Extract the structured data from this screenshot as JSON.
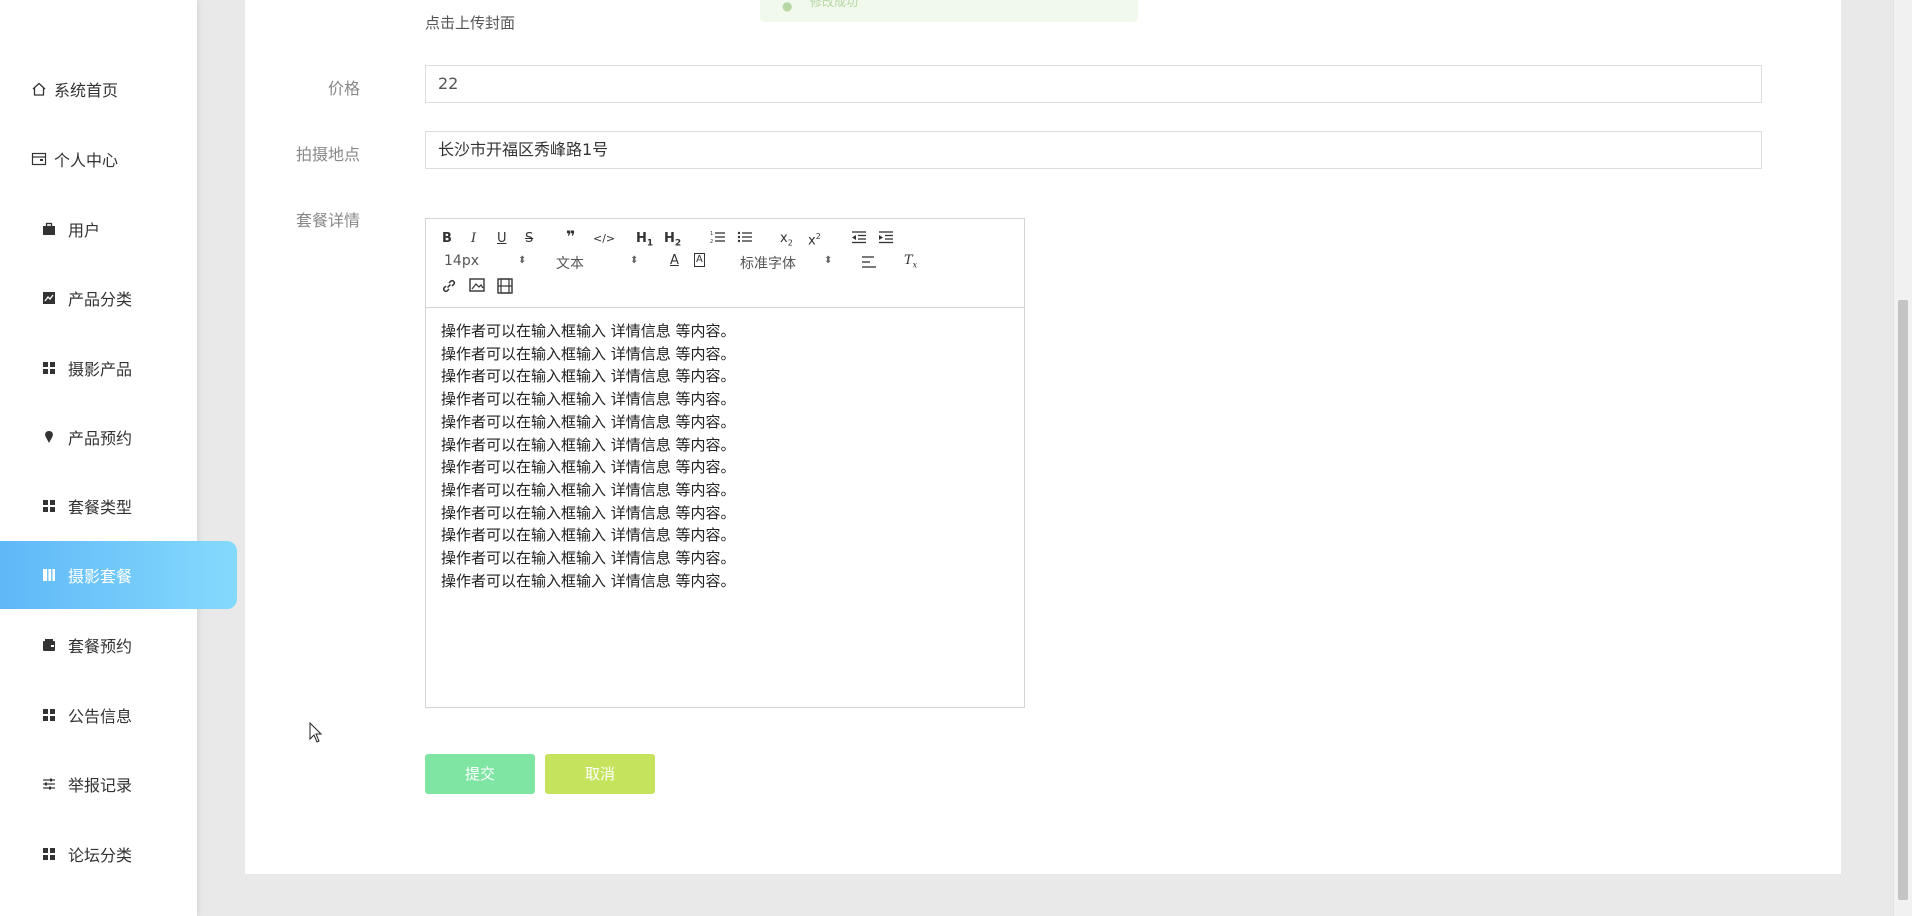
{
  "sidebar": {
    "items": [
      {
        "label": "系统首页",
        "icon": "home-icon"
      },
      {
        "label": "个人中心",
        "icon": "wallet-icon"
      },
      {
        "label": "用户",
        "icon": "briefcase-icon"
      },
      {
        "label": "产品分类",
        "icon": "chart-icon"
      },
      {
        "label": "摄影产品",
        "icon": "grid-icon"
      },
      {
        "label": "产品预约",
        "icon": "location-icon"
      },
      {
        "label": "套餐类型",
        "icon": "grid-icon"
      },
      {
        "label": "摄影套餐",
        "icon": "book-icon",
        "active": true
      },
      {
        "label": "套餐预约",
        "icon": "wallet-icon"
      },
      {
        "label": "公告信息",
        "icon": "grid-icon"
      },
      {
        "label": "举报记录",
        "icon": "sliders-icon"
      },
      {
        "label": "论坛分类",
        "icon": "grid-icon"
      }
    ]
  },
  "toast": {
    "text": "修改成功"
  },
  "form": {
    "cover_hint": "点击上传封面",
    "price": {
      "label": "价格",
      "value": "22"
    },
    "location": {
      "label": "拍摄地点",
      "value": "长沙市开福区秀峰路1号"
    },
    "details": {
      "label": "套餐详情"
    }
  },
  "editor": {
    "font_size": "14px",
    "header_select": "文本",
    "font_family": "标准字体",
    "content_lines": [
      "操作者可以在输入框输入 详情信息 等内容。",
      "操作者可以在输入框输入 详情信息 等内容。",
      "操作者可以在输入框输入 详情信息 等内容。",
      "操作者可以在输入框输入 详情信息 等内容。",
      "操作者可以在输入框输入 详情信息 等内容。",
      "操作者可以在输入框输入 详情信息 等内容。",
      "操作者可以在输入框输入 详情信息 等内容。",
      "操作者可以在输入框输入 详情信息 等内容。",
      "操作者可以在输入框输入 详情信息 等内容。",
      "操作者可以在输入框输入 详情信息 等内容。",
      "操作者可以在输入框输入 详情信息 等内容。",
      "操作者可以在输入框输入 详情信息 等内容。"
    ]
  },
  "buttons": {
    "submit": {
      "label": "提交",
      "color": "#7ee6a2"
    },
    "cancel": {
      "label": "取消",
      "color": "#c5e35c"
    }
  },
  "colors": {
    "active_nav_start": "#5fb8f7",
    "active_nav_end": "#84dafd"
  }
}
